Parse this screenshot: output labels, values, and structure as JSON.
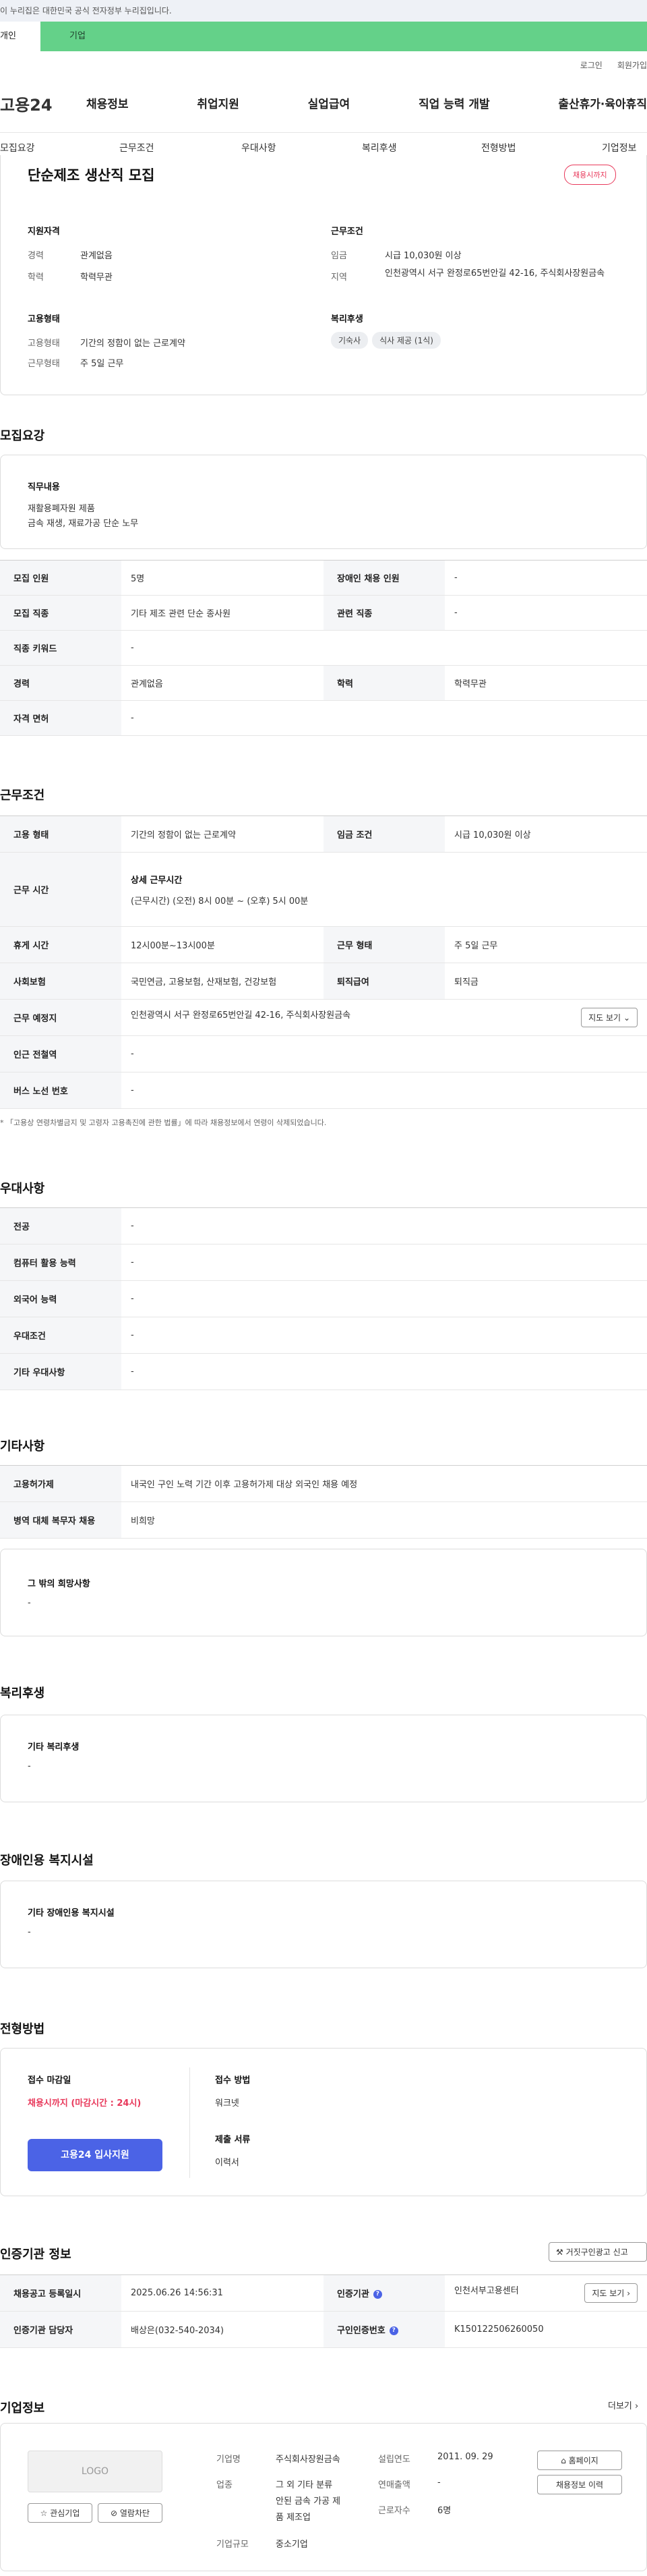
{
  "gov_banner": "이 누리집은 대한민국 공식 전자정부 누리집입니다.",
  "switcher": {
    "individual": "개인",
    "company": "기업"
  },
  "util": {
    "login": "로그인",
    "join": "회원가입"
  },
  "logo": "고용24",
  "gnb": [
    "채용정보",
    "취업지원",
    "실업급여",
    "직업 능력 개발",
    "출산휴가·육아휴직"
  ],
  "subtabs": [
    "모집요강",
    "근무조건",
    "우대사항",
    "복리후생",
    "전형방법",
    "기업정보"
  ],
  "summary": {
    "title": "단순제조 생산직 모집",
    "badge": "채용시까지",
    "qual_heading": "지원자격",
    "career_label": "경력",
    "career_value": "관계없음",
    "edu_label": "학력",
    "edu_value": "학력무관",
    "cond_heading": "근무조건",
    "wage_label": "임금",
    "wage_value": "시급 10,030원 이상",
    "region_label": "지역",
    "region_value": "인천광역시 서구 완정로65번안길 42-16, 주식회사장원금속",
    "emp_heading": "고용형태",
    "emptype_label": "고용형태",
    "emptype_value": "기간의 정함이 없는 근로계약",
    "worktype_label": "근무형태",
    "worktype_value": "주 5일 근무",
    "welfare_heading": "복리후생",
    "welfare_tags": [
      "기숙사",
      "식사 제공 (1식)"
    ]
  },
  "recruit": {
    "heading": "모집요강",
    "duty_title": "직무내용",
    "duty_line1": "재활용폐자원 제품",
    "duty_line2": "금속 재생, 재료가공 단순 노무",
    "rows": [
      {
        "k1": "모집 인원",
        "v1": "5명",
        "k2": "장애인 채용 인원",
        "v2": "-"
      },
      {
        "k1": "모집 직종",
        "v1": "기타 제조 관련 단순 종사원",
        "k2": "관련 직종",
        "v2": "-"
      },
      {
        "k1": "직종 키워드",
        "v1": "-"
      },
      {
        "k1": "경력",
        "v1": "관계없음",
        "k2": "학력",
        "v2": "학력무관"
      },
      {
        "k1": "자격 면허",
        "v1": "-"
      }
    ]
  },
  "conditions": {
    "heading": "근무조건",
    "emptype_k": "고용 형태",
    "emptype_v": "기간의 정함이 없는 근로계약",
    "wage_k": "임금 조건",
    "wage_v": "시급 10,030원 이상",
    "hours_k": "근무 시간",
    "hours_title": "상세 근무시간",
    "hours_v": "(근무시간) (오전) 8시 00분 ~ (오후) 5시 00분",
    "break_k": "휴게 시간",
    "break_v": "12시00분~13시00분",
    "form_k": "근무 형태",
    "form_v": "주 5일 근무",
    "insurance_k": "사회보험",
    "insurance_v": "국민연금, 고용보험, 산재보험, 건강보험",
    "severance_k": "퇴직급여",
    "severance_v": "퇴직금",
    "place_k": "근무 예정지",
    "place_v": "인천광역시 서구 완정로65번안길 42-16, 주식회사장원금속",
    "map_btn": "지도 보기",
    "subway_k": "인근 전철역",
    "subway_v": "-",
    "bus_k": "버스 노선 번호",
    "bus_v": "-",
    "footnote": "* 「고용상 연령차별금지 및 고령자 고용촉진에 관한 법률」에 따라 채용정보에서 연령이 삭제되었습니다."
  },
  "preference": {
    "heading": "우대사항",
    "rows": [
      {
        "k": "전공",
        "v": "-"
      },
      {
        "k": "컴퓨터 활용 능력",
        "v": "-"
      },
      {
        "k": "외국어 능력",
        "v": "-"
      },
      {
        "k": "우대조건",
        "v": "-"
      },
      {
        "k": "기타 우대사항",
        "v": "-"
      }
    ]
  },
  "other": {
    "heading": "기타사항",
    "permit_k": "고용허가제",
    "permit_v": "내국인 구인 노력 기간 이후 고용허가제 대상 외국인 채용 예정",
    "military_k": "병역 대체 복무자 채용",
    "military_v": "비희망",
    "extra_title": "그 밖의 희망사항",
    "extra_v": "-"
  },
  "benefits": {
    "heading": "복리후생",
    "title": "기타 복리후생",
    "value": "-"
  },
  "disability": {
    "heading": "장애인용 복지시설",
    "title": "기타 장애인용 복지시설",
    "value": "-"
  },
  "selection": {
    "heading": "전형방법",
    "deadline_title": "접수 마감일",
    "deadline_value": "채용시까지 (마감시간 : 24시)",
    "apply_btn": "고용24 입사지원",
    "method_title": "접수 방법",
    "method_value": "워크넷",
    "docs_title": "제출 서류",
    "docs_value": "이력서"
  },
  "certification": {
    "heading": "인증기관 정보",
    "report_btn": "거짓구인광고 신고",
    "reg_k": "채용공고 등록일시",
    "reg_v": "2025.06.26 14:56:31",
    "org_k": "인증기관",
    "org_v": "인천서부고용센터",
    "map_btn": "지도 보기",
    "mgr_k": "인증기관 담당자",
    "mgr_v": "배상은(032-540-2034)",
    "num_k": "구인인증번호",
    "num_v": "K150122506260050"
  },
  "company": {
    "heading": "기업정보",
    "more": "더보기",
    "logo_text": "LOGO",
    "interest_btn": "관심기업",
    "block_btn": "열람차단",
    "name_k": "기업명",
    "name_v": "주식회사장원금속",
    "industry_k": "업종",
    "industry_v1": "그 외 기타 분류",
    "industry_v2": "안된 금속 가공 제",
    "industry_v3": "품 제조업",
    "size_k": "기업규모",
    "size_v": "중소기업",
    "founded_k": "설립연도",
    "founded_v": "2011. 09. 29",
    "sales_k": "연매출액",
    "sales_v": "-",
    "staff_k": "근로자수",
    "staff_v": "6명",
    "homepage_btn": "홈페이지",
    "history_btn": "채용정보 이력"
  }
}
